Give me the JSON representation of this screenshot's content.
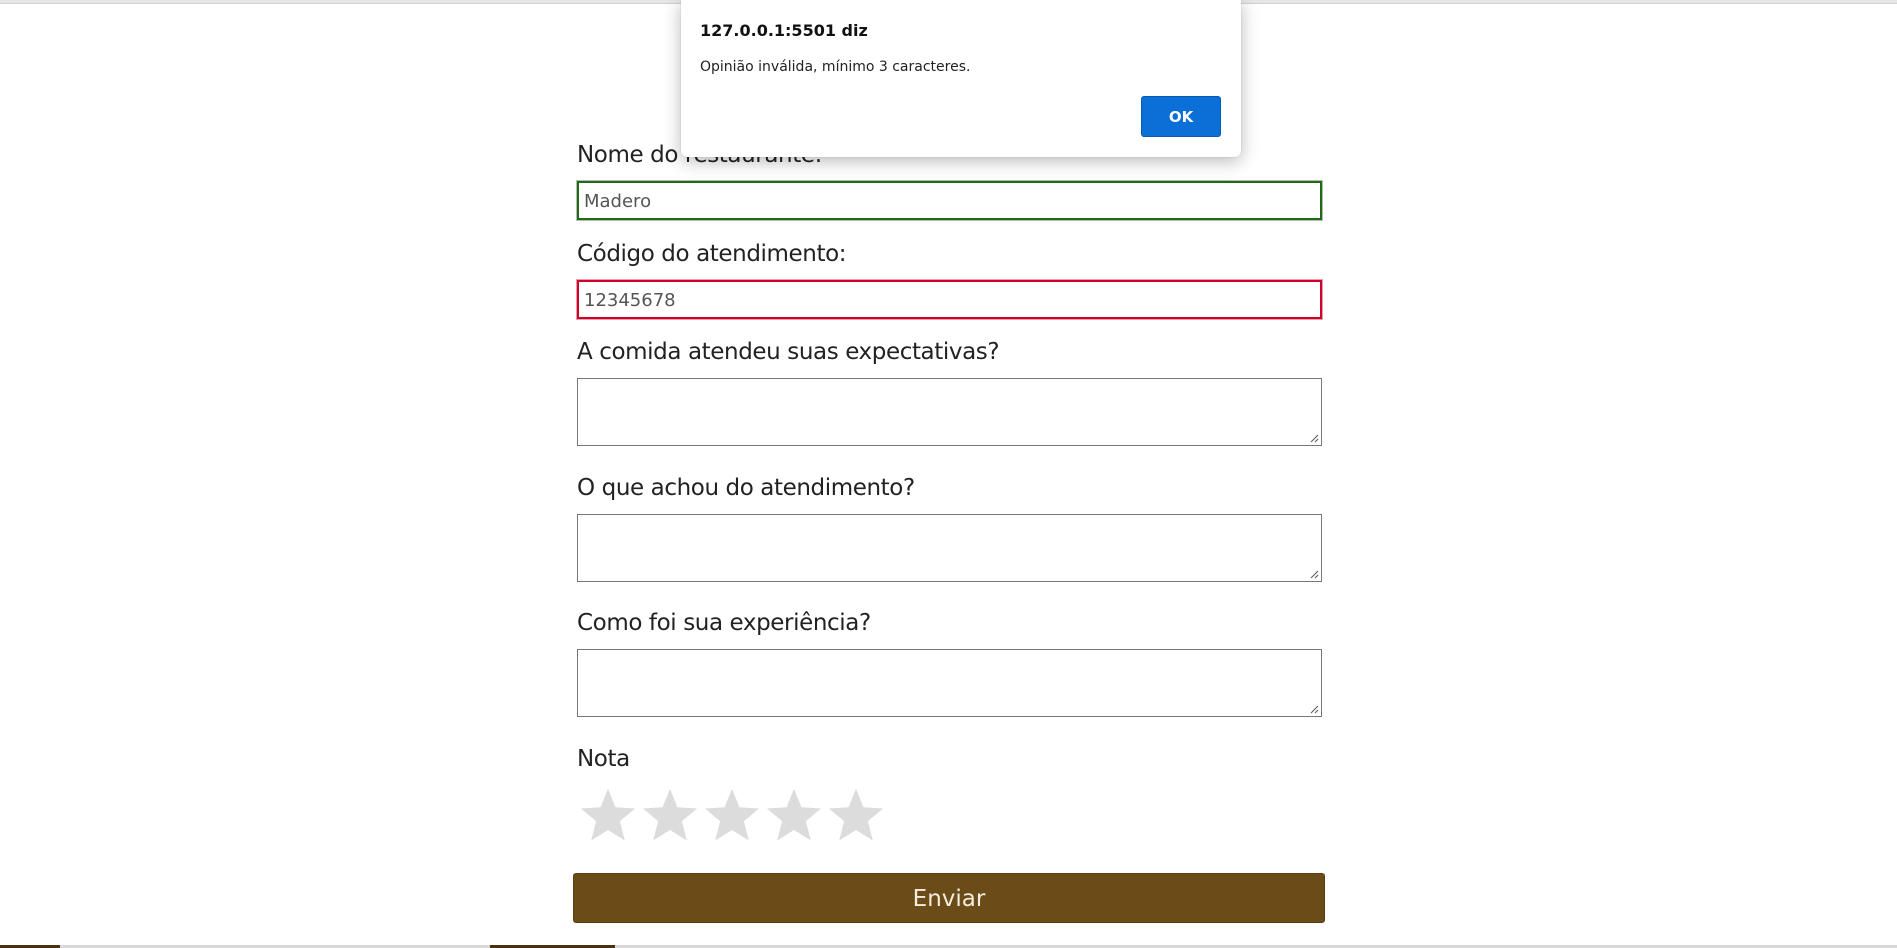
{
  "dialog": {
    "title": "127.0.0.1:5501 diz",
    "message": "Opinião inválida, mínimo 3 caracteres.",
    "ok_label": "OK"
  },
  "form": {
    "restaurant_label": "Nome do restaurante:",
    "restaurant_value": "Madero",
    "code_label": "Código do atendimento:",
    "code_value": "12345678",
    "food_label": "A comida atendeu suas expectativas?",
    "food_value": "",
    "service_label": "O que achou do atendimento?",
    "service_value": "",
    "experience_label": "Como foi sua experiência?",
    "experience_value": "",
    "rating_label": "Nota",
    "rating": {
      "value": 0,
      "max": 5
    },
    "submit_label": "Enviar"
  },
  "colors": {
    "valid_border": "#1d6b12",
    "invalid_border": "#d1002a",
    "submit_bg": "#6b4c18",
    "star_empty": "#dcdcdc",
    "dialog_button": "#0a6fd6"
  }
}
